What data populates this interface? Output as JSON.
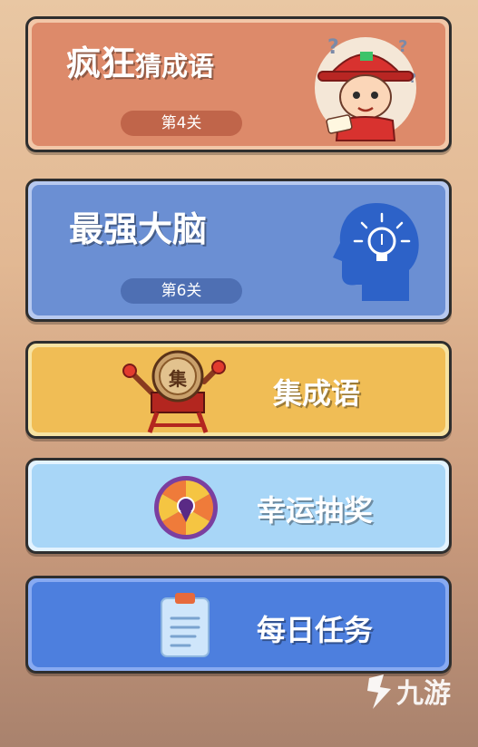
{
  "cards": {
    "idiom_guess": {
      "title_main": "疯狂",
      "title_sub": "猜成语",
      "level": "第4关"
    },
    "brain": {
      "title": "最强大脑",
      "level": "第6关"
    },
    "collect": {
      "title": "集成语",
      "drum_char": "集"
    },
    "lottery": {
      "title": "幸运抽奖"
    },
    "daily": {
      "title": "每日任务"
    }
  },
  "watermark": {
    "text": "九游"
  },
  "colors": {
    "card1_fill": "#dd8a6a",
    "card2_fill": "#6b8fd3",
    "card3_fill": "#f0bd55",
    "card4_fill": "#a8d6f7",
    "card5_fill": "#4d7fde"
  }
}
